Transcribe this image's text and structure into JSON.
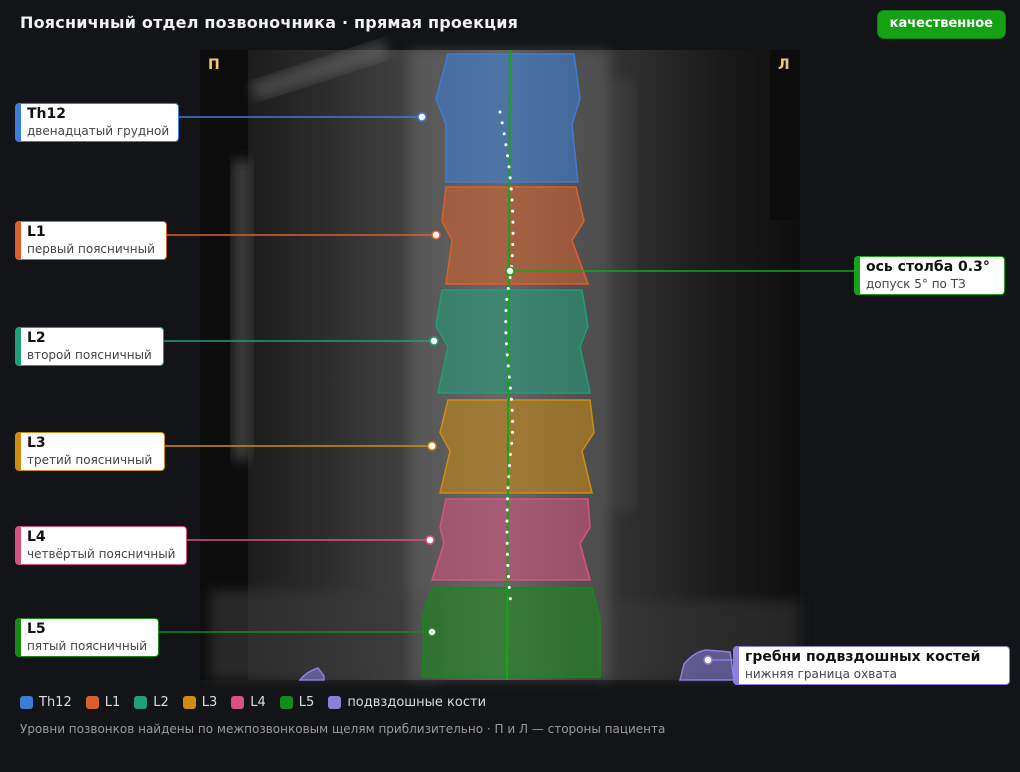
{
  "header": {
    "title": "Поясничный отдел позвоночника · прямая проекция",
    "badge": "качественное"
  },
  "image": {
    "side_right": "П",
    "side_left": "Л"
  },
  "vertebrae": [
    {
      "id": "Th12",
      "name": "Th12",
      "desc": "двенадцатый грудной",
      "color": "#3b7dd8"
    },
    {
      "id": "L1",
      "name": "L1",
      "desc": "первый поясничный",
      "color": "#d9602b"
    },
    {
      "id": "L2",
      "name": "L2",
      "desc": "второй поясничный",
      "color": "#1f9e77"
    },
    {
      "id": "L3",
      "name": "L3",
      "desc": "третий поясничный",
      "color": "#d08c12"
    },
    {
      "id": "L4",
      "name": "L4",
      "desc": "четвёртый поясничный",
      "color": "#d9527f"
    },
    {
      "id": "L5",
      "name": "L5",
      "desc": "пятый поясничный",
      "color": "#158a15"
    }
  ],
  "axis": {
    "name": "ось столба 0.3°",
    "desc": "допуск 5° по ТЗ",
    "color": "#17a317"
  },
  "iliac": {
    "name": "гребни подвздошных костей",
    "desc": "нижняя граница охвата",
    "color": "#8b7fe0"
  },
  "legend": [
    {
      "label": "Th12",
      "color": "#3b7dd8"
    },
    {
      "label": "L1",
      "color": "#d9602b"
    },
    {
      "label": "L2",
      "color": "#1f9e77"
    },
    {
      "label": "L3",
      "color": "#d08c12"
    },
    {
      "label": "L4",
      "color": "#d9527f"
    },
    {
      "label": "L5",
      "color": "#158a15"
    },
    {
      "label": "подвздошные кости",
      "color": "#8b7fe0"
    }
  ],
  "footnote": "Уровни позвонков найдены по межпозвонковым щелям приблизительно · П и Л — стороны пациента"
}
